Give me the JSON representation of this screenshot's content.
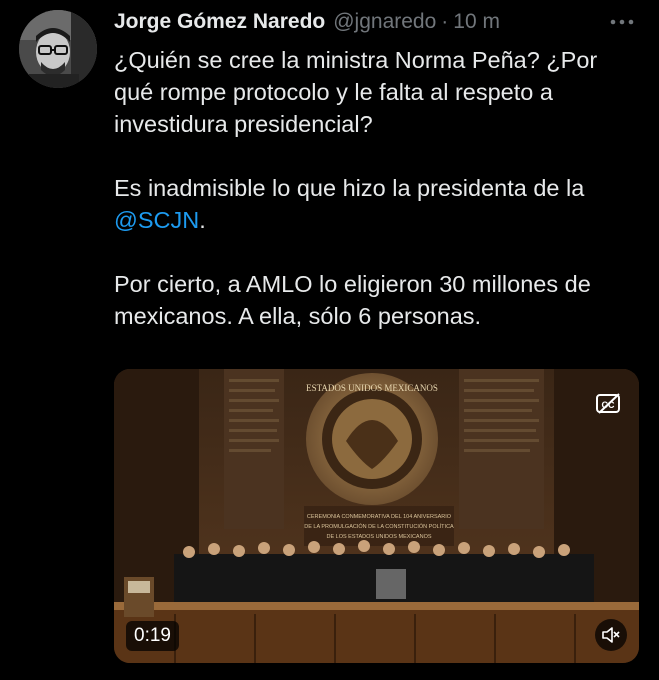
{
  "tweet": {
    "author": {
      "display_name": "Jorge Gómez Naredo",
      "handle": "@jgnaredo",
      "separator": "·",
      "time": "10 m",
      "avatar": "profile-photo"
    },
    "text": {
      "p1": "¿Quién se cree la ministra Norma Peña? ¿Por qué rompe protocolo y le falta al respeto a investidura presidencial?",
      "p2_before": "Es inadmisible lo que hizo la presidenta de la ",
      "p2_mention": "@SCJN",
      "p2_after": ".",
      "p3": "Por cierto, a AMLO lo eligieron 30 millones de mexicanos. A ella, sólo 6 personas."
    },
    "media": {
      "type": "video",
      "duration": "0:19",
      "seal_text": "ESTADOS UNIDOS MEXICANOS",
      "banner_lines": [
        "CEREMONIA CONMEMORATIVA DEL 104 ANIVERSARIO",
        "DE LA PROMULGACIÓN DE LA CONSTITUCIÓN POLÍTICA",
        "DE LOS ESTADOS UNIDOS MEXICANOS"
      ]
    },
    "icons": {
      "more": "more-horizontal-icon",
      "captions": "captions-icon",
      "mute": "volume-muted-icon"
    },
    "colors": {
      "background": "#000000",
      "text": "#e7e9ea",
      "secondary": "#71767b",
      "link": "#1d9bf0"
    }
  }
}
